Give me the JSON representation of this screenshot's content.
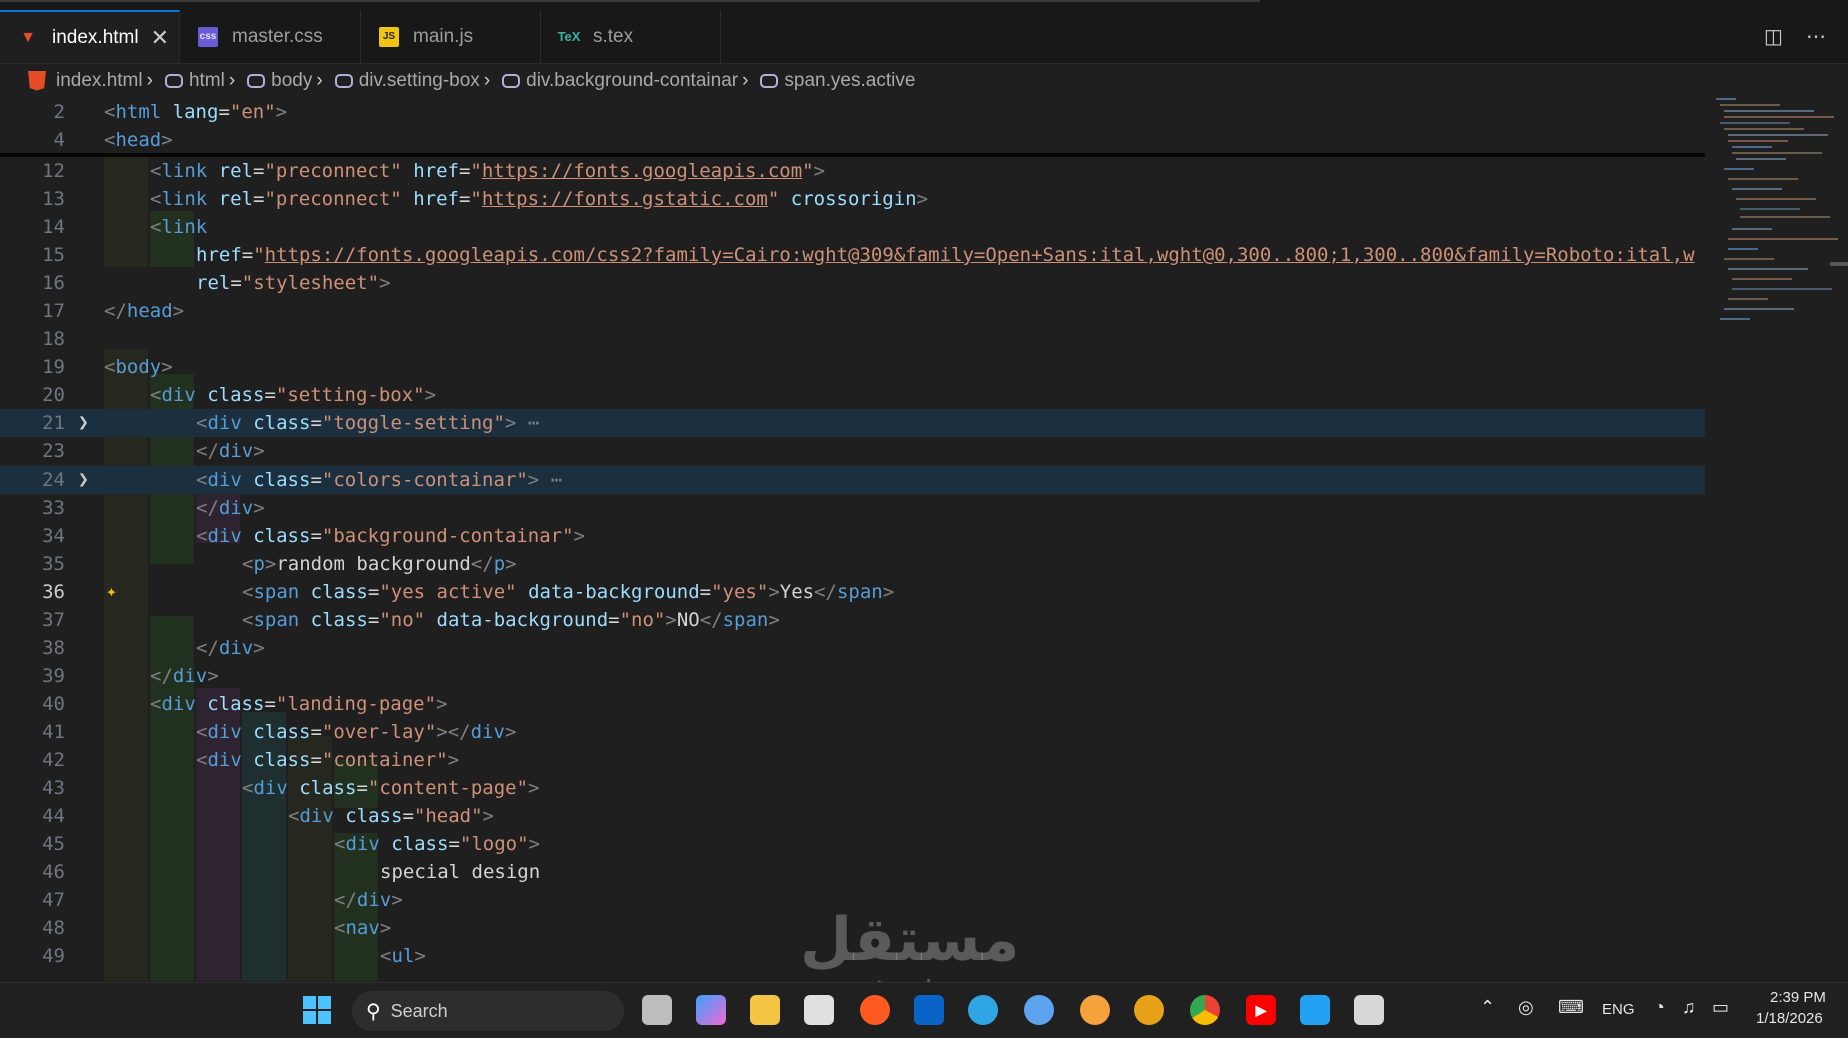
{
  "tabs": [
    {
      "label": "index.html",
      "icon": "html5-icon",
      "active": true
    },
    {
      "label": "master.css",
      "icon": "css-icon"
    },
    {
      "label": "main.js",
      "icon": "js-icon"
    },
    {
      "label": "s.tex",
      "icon": "tex-icon"
    }
  ],
  "breadcrumb": [
    "index.html",
    "html",
    "body",
    "div.setting-box",
    "div.background-containar",
    "span.yes.active"
  ],
  "line_numbers": [
    "2",
    "4",
    "12",
    "13",
    "14",
    "15",
    "16",
    "17",
    "18",
    "19",
    "20",
    "21",
    "23",
    "24",
    "33",
    "34",
    "35",
    "36",
    "37",
    "38",
    "39",
    "40",
    "41",
    "42",
    "43",
    "44",
    "45",
    "46",
    "47",
    "48",
    "49"
  ],
  "code": {
    "l2_tag": "html",
    "l2_attr": "lang",
    "l2_val": "\"en\"",
    "l4_tag": "head",
    "l12_tag": "link",
    "l12_a1": "rel",
    "l12_v1": "\"preconnect\"",
    "l12_a2": "href",
    "l12_url": "https://fonts.googleapis.com",
    "l13_url": "https://fonts.gstatic.com",
    "l13_a3": "crossorigin",
    "l15_url": "https://fonts.googleapis.com/css2?family=Cairo:wght@309&family=Open+Sans:ital,wght@0,300..800;1,300..800&family=Roboto:ital,w",
    "l16_val": "\"stylesheet\"",
    "l20_val": "\"setting-box\"",
    "l21_val": "\"toggle-setting\"",
    "l24_val": "\"colors-containar\"",
    "l34_val": "\"background-containar\"",
    "l35_text": "random background",
    "l36_val1": "\"yes active\"",
    "l36_attr2": "data-background",
    "l36_val2": "\"yes\"",
    "l36_text": "Yes",
    "l37_val1": "\"no\"",
    "l37_val2": "\"no\"",
    "l37_text": "NO",
    "l40_val": "\"landing-page\"",
    "l41_val": "\"over-lay\"",
    "l42_val": "\"container\"",
    "l43_val": "\"content-page\"",
    "l44_val": "\"head\"",
    "l45_val": "\"logo\"",
    "l46_text": "special design",
    "l48_tag": "nav",
    "l49_tag": "ul"
  },
  "taskbar": {
    "search_label": "Search",
    "lang": "ENG",
    "time": "2:39 PM",
    "date": "1/18/2026"
  },
  "watermark": {
    "arabic": "مستقل",
    "latin": "mostaql.com"
  },
  "colors": {
    "accent": "#0078d4",
    "tag": "#569cd6",
    "attr": "#9cdcfe",
    "string": "#ce9178"
  }
}
